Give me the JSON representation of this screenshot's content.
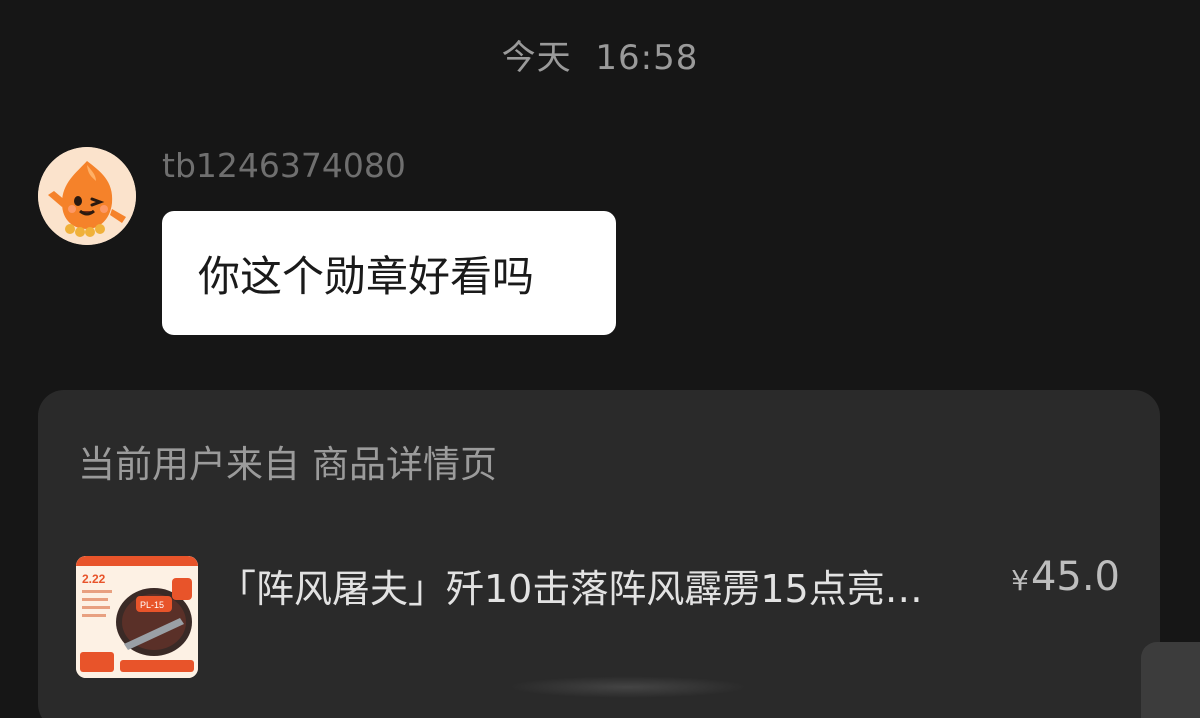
{
  "header": {
    "day": "今天",
    "time": "16:58"
  },
  "message": {
    "sender": "tb1246374080",
    "text": "你这个勋章好看吗",
    "avatar_icon": "orange-mascot-avatar"
  },
  "card": {
    "source_prefix": "当前用户来自",
    "source_page": "商品详情页",
    "product": {
      "title": "「阵风屠夫」歼10击落阵风霹雳15点亮…",
      "price_currency": "¥",
      "price_value": "45.0",
      "thumb_icon": "product-badge-thumbnail"
    }
  },
  "colors": {
    "background": "#161616",
    "card": "#2a2a2a",
    "bubble": "#ffffff",
    "accent": "#e8542a"
  }
}
